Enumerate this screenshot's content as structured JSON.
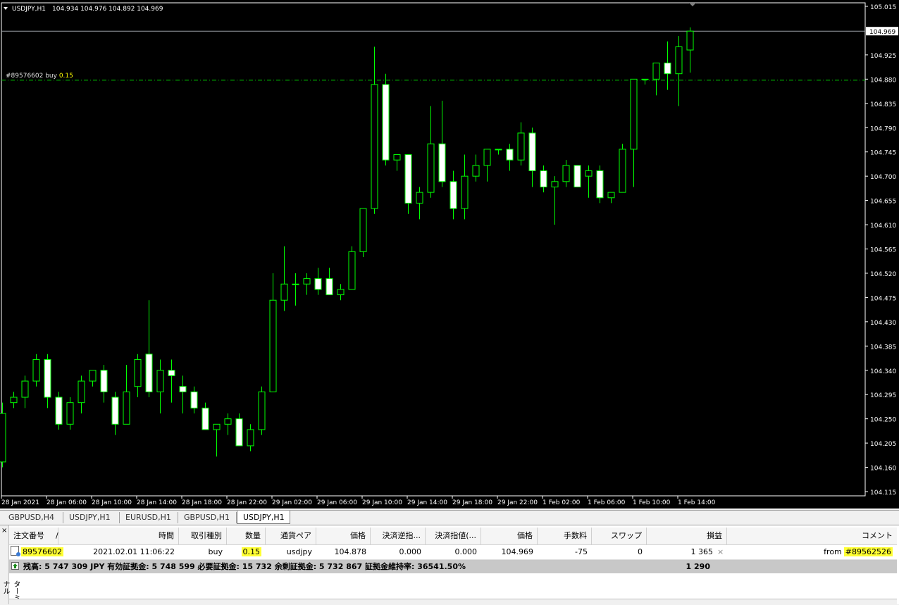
{
  "chart": {
    "symbol_header": "USDJPY,H1",
    "ohlc_header": "104.934 104.976 104.892 104.969",
    "order_label": "#89576602 buy",
    "order_lots": "0.15",
    "current_price": "104.969",
    "colors": {
      "background": "#000000",
      "candle": "#00ff00",
      "bull_fill": "#000000",
      "bear_fill": "#ffffff",
      "axis_text": "#ffffff",
      "order_line": "#00c000",
      "order_lots": "#ffff00"
    },
    "price_ticks": [
      "105.015",
      "104.969",
      "104.925",
      "104.880",
      "104.835",
      "104.790",
      "104.745",
      "104.700",
      "104.655",
      "104.610",
      "104.565",
      "104.520",
      "104.475",
      "104.430",
      "104.385",
      "104.340",
      "104.295",
      "104.250",
      "104.205",
      "104.160",
      "104.115"
    ],
    "time_ticks": [
      "28 Jan 2021",
      "28 Jan 06:00",
      "28 Jan 10:00",
      "28 Jan 14:00",
      "28 Jan 18:00",
      "28 Jan 22:00",
      "29 Jan 02:00",
      "29 Jan 06:00",
      "29 Jan 10:00",
      "29 Jan 14:00",
      "29 Jan 18:00",
      "29 Jan 22:00",
      "1 Feb 02:00",
      "1 Feb 06:00",
      "1 Feb 10:00",
      "1 Feb 14:00"
    ]
  },
  "chart_data": {
    "type": "candlestick",
    "symbol": "USDJPY",
    "timeframe": "H1",
    "ylim": [
      104.115,
      105.015
    ],
    "order_price": 104.878,
    "current_price": 104.969,
    "candles": [
      {
        "o": 104.17,
        "h": 104.28,
        "l": 104.16,
        "c": 104.26
      },
      {
        "o": 104.28,
        "h": 104.3,
        "l": 104.27,
        "c": 104.29
      },
      {
        "o": 104.29,
        "h": 104.33,
        "l": 104.27,
        "c": 104.32
      },
      {
        "o": 104.32,
        "h": 104.37,
        "l": 104.31,
        "c": 104.36
      },
      {
        "o": 104.36,
        "h": 104.37,
        "l": 104.27,
        "c": 104.29
      },
      {
        "o": 104.29,
        "h": 104.3,
        "l": 104.23,
        "c": 104.24
      },
      {
        "o": 104.24,
        "h": 104.29,
        "l": 104.23,
        "c": 104.28
      },
      {
        "o": 104.28,
        "h": 104.33,
        "l": 104.26,
        "c": 104.32
      },
      {
        "o": 104.32,
        "h": 104.34,
        "l": 104.31,
        "c": 104.34
      },
      {
        "o": 104.34,
        "h": 104.35,
        "l": 104.28,
        "c": 104.3
      },
      {
        "o": 104.29,
        "h": 104.3,
        "l": 104.22,
        "c": 104.24
      },
      {
        "o": 104.24,
        "h": 104.35,
        "l": 104.24,
        "c": 104.3
      },
      {
        "o": 104.31,
        "h": 104.37,
        "l": 104.29,
        "c": 104.36
      },
      {
        "o": 104.37,
        "h": 104.47,
        "l": 104.29,
        "c": 104.3
      },
      {
        "o": 104.3,
        "h": 104.36,
        "l": 104.26,
        "c": 104.34
      },
      {
        "o": 104.34,
        "h": 104.36,
        "l": 104.28,
        "c": 104.33
      },
      {
        "o": 104.31,
        "h": 104.33,
        "l": 104.26,
        "c": 104.3
      },
      {
        "o": 104.3,
        "h": 104.31,
        "l": 104.26,
        "c": 104.27
      },
      {
        "o": 104.27,
        "h": 104.28,
        "l": 104.23,
        "c": 104.23
      },
      {
        "o": 104.23,
        "h": 104.24,
        "l": 104.18,
        "c": 104.24
      },
      {
        "o": 104.24,
        "h": 104.26,
        "l": 104.22,
        "c": 104.25
      },
      {
        "o": 104.25,
        "h": 104.26,
        "l": 104.2,
        "c": 104.2
      },
      {
        "o": 104.2,
        "h": 104.24,
        "l": 104.19,
        "c": 104.23
      },
      {
        "o": 104.23,
        "h": 104.31,
        "l": 104.22,
        "c": 104.3
      },
      {
        "o": 104.3,
        "h": 104.52,
        "l": 104.3,
        "c": 104.47
      },
      {
        "o": 104.47,
        "h": 104.57,
        "l": 104.45,
        "c": 104.5
      },
      {
        "o": 104.5,
        "h": 104.52,
        "l": 104.46,
        "c": 104.5
      },
      {
        "o": 104.5,
        "h": 104.52,
        "l": 104.48,
        "c": 104.51
      },
      {
        "o": 104.51,
        "h": 104.53,
        "l": 104.48,
        "c": 104.49
      },
      {
        "o": 104.51,
        "h": 104.53,
        "l": 104.48,
        "c": 104.48
      },
      {
        "o": 104.48,
        "h": 104.5,
        "l": 104.47,
        "c": 104.49
      },
      {
        "o": 104.49,
        "h": 104.57,
        "l": 104.49,
        "c": 104.56
      },
      {
        "o": 104.56,
        "h": 104.64,
        "l": 104.55,
        "c": 104.64
      },
      {
        "o": 104.64,
        "h": 104.94,
        "l": 104.63,
        "c": 104.87
      },
      {
        "o": 104.87,
        "h": 104.89,
        "l": 104.72,
        "c": 104.73
      },
      {
        "o": 104.73,
        "h": 104.74,
        "l": 104.71,
        "c": 104.74
      },
      {
        "o": 104.74,
        "h": 104.74,
        "l": 104.63,
        "c": 104.65
      },
      {
        "o": 104.65,
        "h": 104.68,
        "l": 104.62,
        "c": 104.67
      },
      {
        "o": 104.67,
        "h": 104.83,
        "l": 104.66,
        "c": 104.76
      },
      {
        "o": 104.76,
        "h": 104.84,
        "l": 104.68,
        "c": 104.69
      },
      {
        "o": 104.69,
        "h": 104.71,
        "l": 104.62,
        "c": 104.64
      },
      {
        "o": 104.64,
        "h": 104.74,
        "l": 104.62,
        "c": 104.7
      },
      {
        "o": 104.7,
        "h": 104.74,
        "l": 104.69,
        "c": 104.72
      },
      {
        "o": 104.72,
        "h": 104.75,
        "l": 104.69,
        "c": 104.75
      },
      {
        "o": 104.75,
        "h": 104.75,
        "l": 104.74,
        "c": 104.75
      },
      {
        "o": 104.75,
        "h": 104.76,
        "l": 104.71,
        "c": 104.73
      },
      {
        "o": 104.73,
        "h": 104.8,
        "l": 104.72,
        "c": 104.78
      },
      {
        "o": 104.78,
        "h": 104.79,
        "l": 104.68,
        "c": 104.71
      },
      {
        "o": 104.71,
        "h": 104.72,
        "l": 104.67,
        "c": 104.68
      },
      {
        "o": 104.68,
        "h": 104.7,
        "l": 104.61,
        "c": 104.69
      },
      {
        "o": 104.69,
        "h": 104.73,
        "l": 104.68,
        "c": 104.72
      },
      {
        "o": 104.72,
        "h": 104.72,
        "l": 104.68,
        "c": 104.68
      },
      {
        "o": 104.7,
        "h": 104.72,
        "l": 104.66,
        "c": 104.71
      },
      {
        "o": 104.71,
        "h": 104.72,
        "l": 104.65,
        "c": 104.66
      },
      {
        "o": 104.66,
        "h": 104.67,
        "l": 104.65,
        "c": 104.67
      },
      {
        "o": 104.67,
        "h": 104.76,
        "l": 104.67,
        "c": 104.75
      },
      {
        "o": 104.75,
        "h": 104.88,
        "l": 104.68,
        "c": 104.88
      },
      {
        "o": 104.88,
        "h": 104.88,
        "l": 104.87,
        "c": 104.88
      },
      {
        "o": 104.88,
        "h": 104.91,
        "l": 104.85,
        "c": 104.91
      },
      {
        "o": 104.91,
        "h": 104.95,
        "l": 104.86,
        "c": 104.89
      },
      {
        "o": 104.89,
        "h": 104.96,
        "l": 104.83,
        "c": 104.94
      },
      {
        "o": 104.934,
        "h": 104.976,
        "l": 104.892,
        "c": 104.969
      }
    ]
  },
  "tabs": [
    "GBPUSD,H4",
    "USDJPY,H1",
    "EURUSD,H1",
    "GBPUSD,H1",
    "USDJPY,H1"
  ],
  "terminal": {
    "side_label": "ターミナル",
    "close_symbol": "×",
    "headers": [
      "注文番号",
      "/",
      "時間",
      "取引種別",
      "数量",
      "通貨ペア",
      "価格",
      "決済逆指...",
      "決済指値(...",
      "価格",
      "手数料",
      "スワップ",
      "損益",
      "コメント"
    ],
    "row": {
      "order_id": "89576602",
      "time": "2021.02.01 11:06:22",
      "type": "buy",
      "volume": "0.15",
      "symbol": "usdjpy",
      "open_price": "104.878",
      "sl": "0.000",
      "tp": "0.000",
      "price": "104.969",
      "commission": "-75",
      "swap": "0",
      "profit": "1 365",
      "close_x": "×",
      "comment_prefix": "from",
      "comment_ref": "#89562526"
    },
    "summary": {
      "text": "残高: 5 747 309 JPY  有効証拠金: 5 748 599  必要証拠金: 15 732  余剰証拠金: 5 732 867  証拠金維持率: 36541.50%",
      "total": "1 290"
    }
  }
}
